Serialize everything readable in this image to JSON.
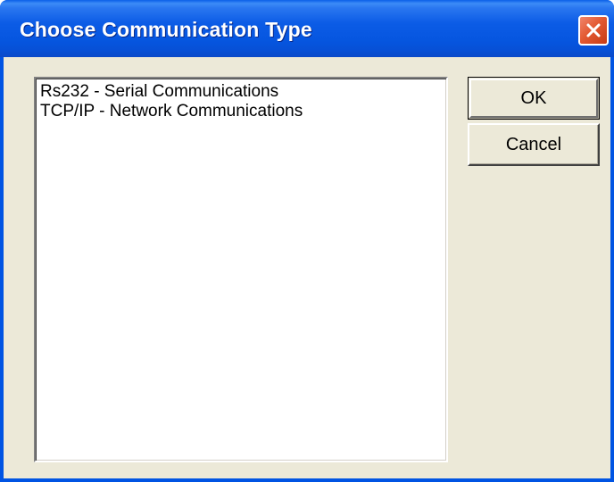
{
  "window": {
    "title": "Choose Communication Type"
  },
  "list": {
    "items": [
      "Rs232 - Serial Communications",
      "TCP/IP - Network Communications"
    ]
  },
  "buttons": {
    "ok_label": "OK",
    "cancel_label": "Cancel"
  },
  "icons": {
    "close": "close-icon"
  },
  "colors": {
    "titlebar": "#0a5fe8",
    "client_background": "#ece9d8",
    "close_button": "#e35a33"
  }
}
